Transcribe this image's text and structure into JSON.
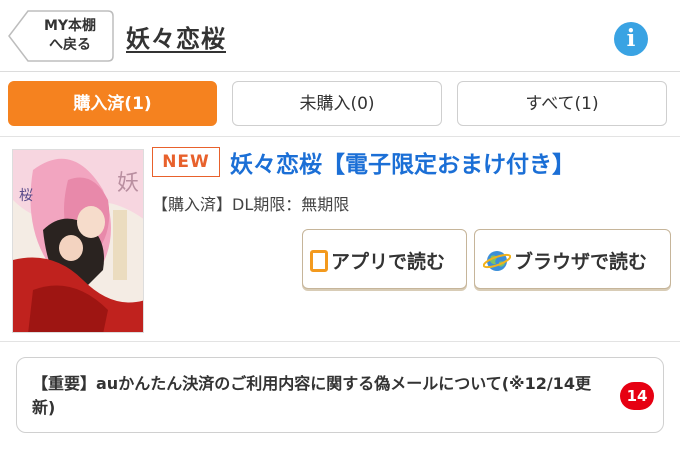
{
  "header": {
    "back_label_line1": "MY本棚",
    "back_label_line2": "へ戻る",
    "title": "妖々恋桜",
    "info_icon": "info-icon"
  },
  "tabs": [
    {
      "label": "購入済(1)",
      "active": true
    },
    {
      "label": "未購入(0)",
      "active": false
    },
    {
      "label": "すべて(1)",
      "active": false
    }
  ],
  "book": {
    "badge": "NEW",
    "title": "妖々恋桜【電子限定おまけ付き】",
    "status": "【購入済】DL期限：無期限",
    "cover_icon": "manga-cover-image",
    "app_button": {
      "label": "アプリで読む",
      "icon": "smartphone-icon"
    },
    "browser_button": {
      "label": "ブラウザで読む",
      "icon": "globe-icon"
    }
  },
  "notice": {
    "text": "【重要】auかんたん決済のご利用内容に関する偽メールについて(※12/14更新)",
    "count": "14"
  },
  "colors": {
    "accent": "#f5821f",
    "link": "#1b6fd6",
    "badge_red": "#e60012",
    "info_blue": "#3aa3e3"
  }
}
